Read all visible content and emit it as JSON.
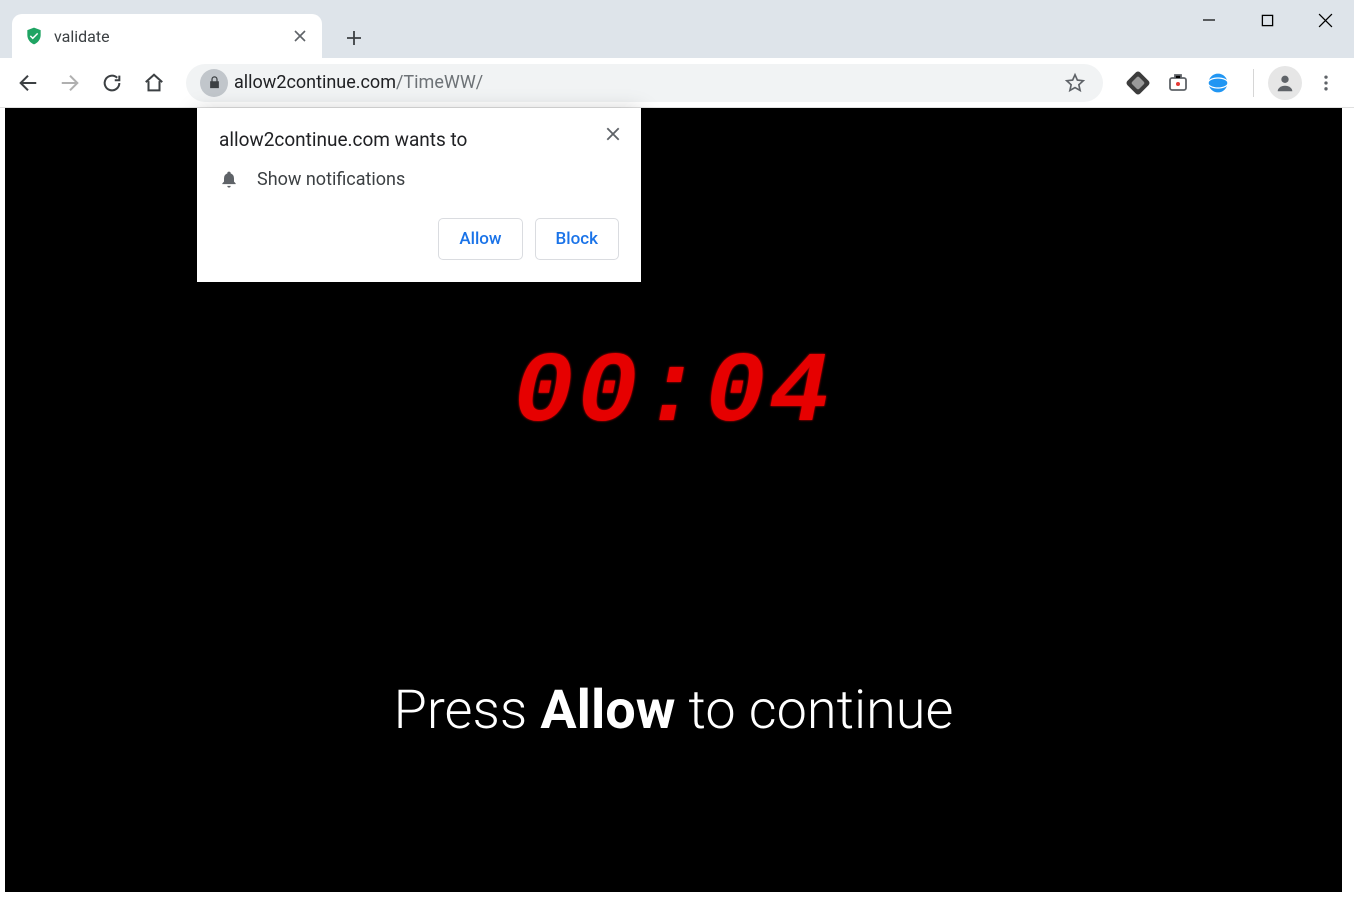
{
  "tab": {
    "title": "validate"
  },
  "address": {
    "domain": "allow2continue.com",
    "path": "/TimeWW/"
  },
  "permission": {
    "title": "allow2continue.com wants to",
    "item": "Show notifications",
    "allow": "Allow",
    "block": "Block"
  },
  "page": {
    "countdown": "00:04",
    "msg_pre": "Press ",
    "msg_bold": "Allow",
    "msg_post": " to continue"
  }
}
